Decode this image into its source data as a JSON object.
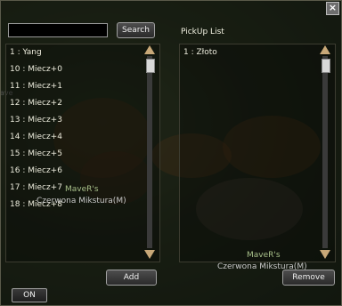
{
  "window": {
    "close_glyph": "×"
  },
  "search": {
    "value": "",
    "button_label": "Search"
  },
  "left_list": {
    "items": [
      "1 : Yang",
      "10 : Miecz+0",
      "11 : Miecz+1",
      "12 : Miecz+2",
      "13 : Miecz+3",
      "14 : Miecz+4",
      "15 : Miecz+5",
      "16 : Miecz+6",
      "17 : Miecz+7",
      "18 : Miecz+8"
    ]
  },
  "pickup": {
    "title": "PickUp List",
    "items": [
      "1 : Złoto"
    ]
  },
  "buttons": {
    "add": "Add",
    "remove": "Remove",
    "on": "ON"
  },
  "overlays": {
    "player1_name": "MaveR's",
    "player1_item": "Czerwona Mikstura(M)",
    "player2_name": "MaveR's",
    "player2_item": "Czerwona Mikstura(M)",
    "side_fragment": "ave"
  },
  "icons": {
    "close": "close-icon",
    "scroll_up": "scroll-up-arrow-icon",
    "scroll_down": "scroll-down-arrow-icon"
  },
  "colors": {
    "arrow": "#c8a878",
    "name_tag": "#a8c08a",
    "panel_bg": "#0a0c08"
  }
}
